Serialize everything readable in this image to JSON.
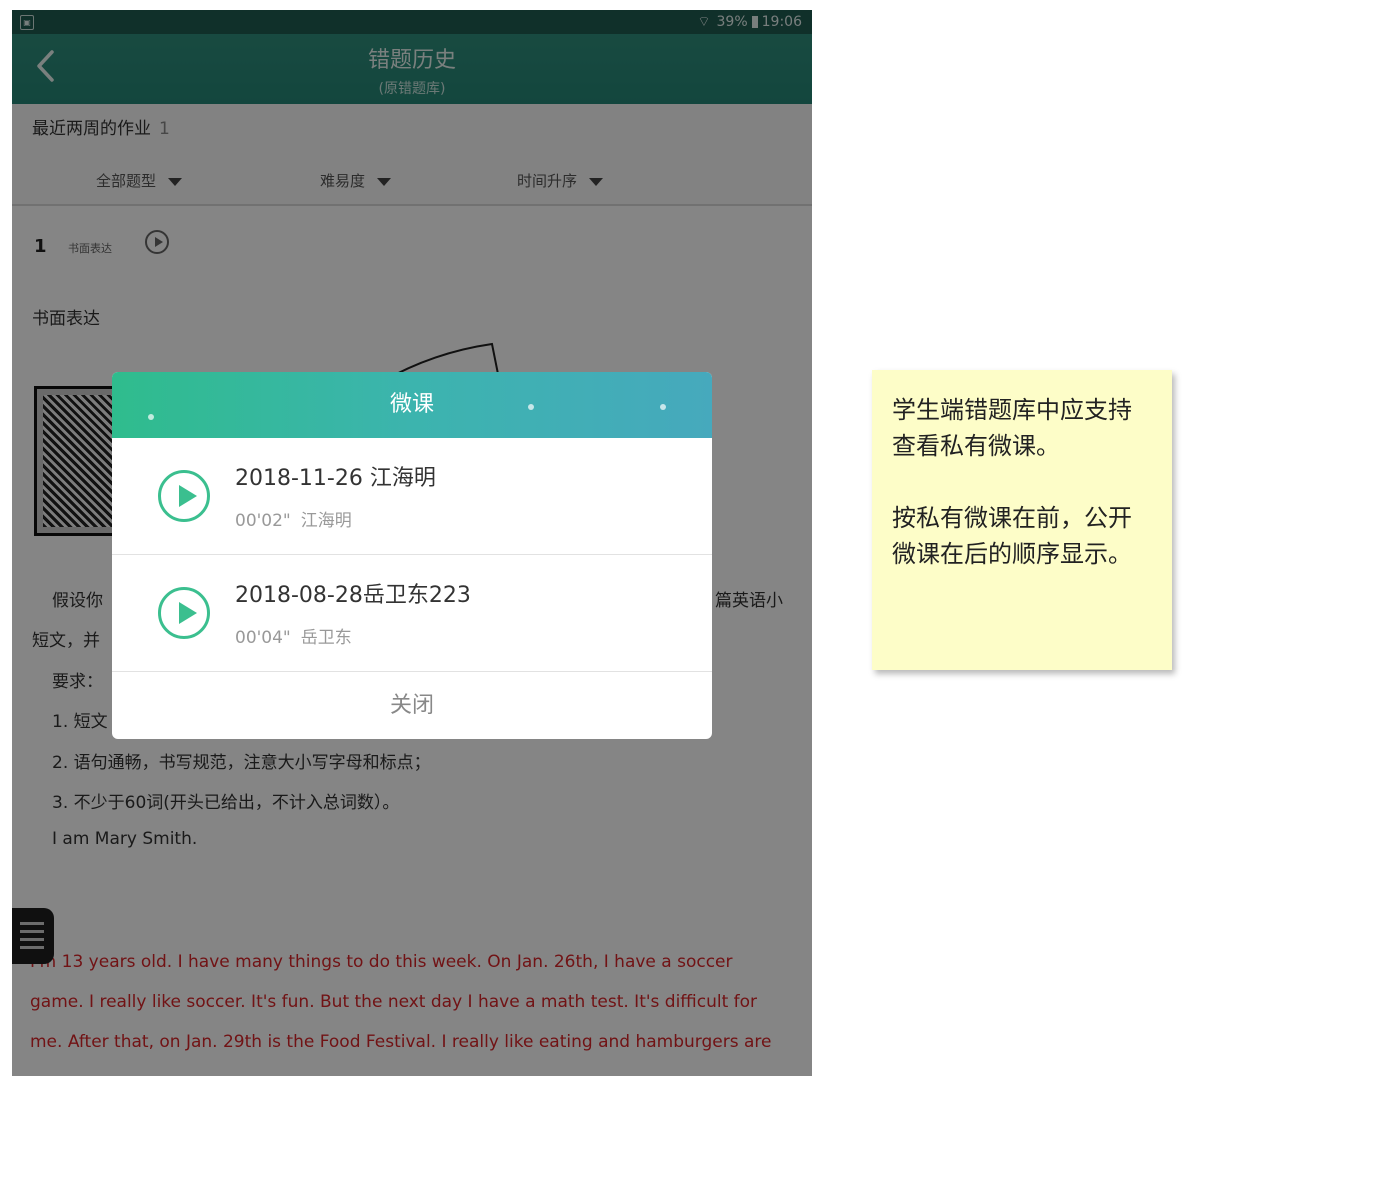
{
  "status_bar": {
    "battery": "39%",
    "time": "19:06"
  },
  "header": {
    "back_icon": "chevron-left-icon",
    "title": "错题历史",
    "subtitle": "(原错题库)"
  },
  "recent": {
    "label": "最近两周的作业",
    "count": "1"
  },
  "filters": [
    {
      "label": "全部题型"
    },
    {
      "label": "难易度"
    },
    {
      "label": "时间升序"
    }
  ],
  "question": {
    "number": "1",
    "tag": "书面表达",
    "title": "书面表达",
    "partial_left": [
      "假设你",
      "短文，并",
      "要求：",
      "1. 短文"
    ],
    "partial_right": "篇英语小",
    "req2": "2. 语句通畅，书写规范，注意大小写字母和标点；",
    "req3": "3. 不少于60词(开头已给出，不计入总词数）。",
    "opening": "I am Mary Smith.",
    "answer_lines": [
      "I'm 13 years old. I have many things to do this week. On Jan. 26th, I have a soccer",
      "game. I really like soccer. It's fun. But the next day I have a math test. It's difficult for",
      "me. After that, on Jan. 29th is the Food Festival. I really like eating and hamburgers are"
    ]
  },
  "dialog": {
    "title": "微课",
    "items": [
      {
        "title": "2018-11-26 江海明",
        "duration": "00'02\"",
        "author": "江海明"
      },
      {
        "title": "2018-08-28岳卫东223",
        "duration": "00'04\"",
        "author": "岳卫东"
      }
    ],
    "close_label": "关闭",
    "accent": "#3bbf8f"
  },
  "note": {
    "paragraph1": "学生端错题库中应支持查看私有微课。",
    "paragraph2": "按私有微课在前，公开微课在后的顺序显示。",
    "background": "#fdfdc8"
  }
}
